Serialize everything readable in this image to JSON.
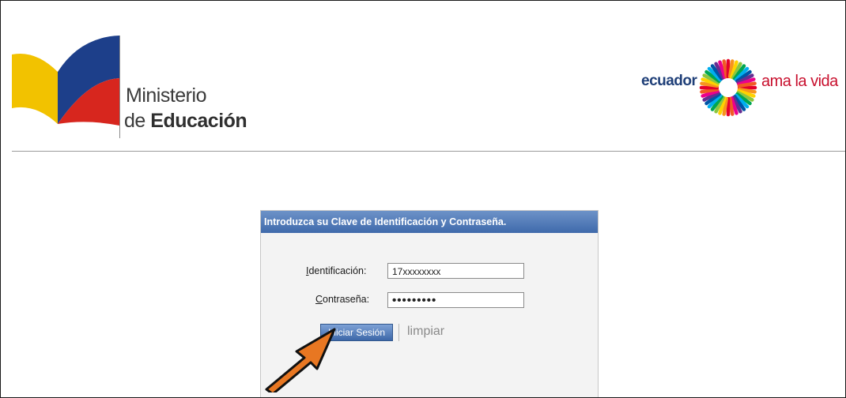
{
  "header": {
    "ministry_line1": "Ministerio",
    "ministry_line2_prefix": "de ",
    "ministry_line2_bold": "Educación",
    "brand_left": "ecuador",
    "brand_right": "ama la vida"
  },
  "login": {
    "title": "Introduzca su Clave de Identificación y Contraseña.",
    "id_label_first": "I",
    "id_label_rest": "dentificación:",
    "id_value": "17xxxxxxxx",
    "pw_label_first": "C",
    "pw_label_rest": "ontraseña:",
    "pw_value": "•••••••••",
    "login_button": "Iniciar Sesión",
    "clear_link": "limpiar"
  },
  "colors": {
    "ministry_yellow": "#f2c200",
    "ministry_blue": "#1d3f8a",
    "ministry_red": "#d7261e",
    "panel_header": "#4a73b2",
    "button": "#4e7bbf",
    "arrow": "#e87722"
  },
  "icons": {
    "annotation": "arrow-pointer-icon"
  }
}
